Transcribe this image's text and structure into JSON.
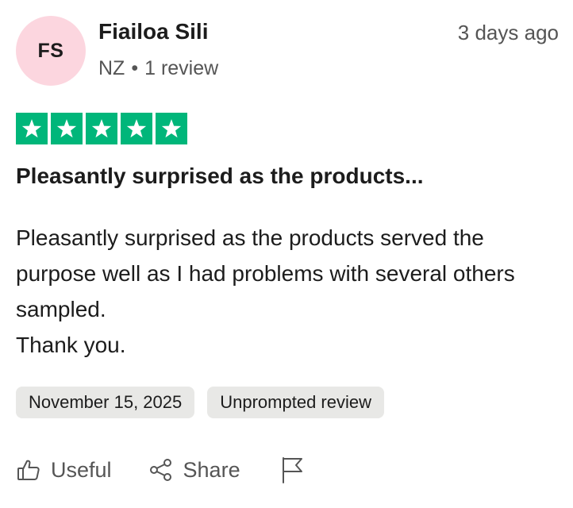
{
  "reviewer": {
    "initials": "FS",
    "name": "Fiailoa Sili",
    "country": "NZ",
    "separator": "•",
    "review_count": "1 review"
  },
  "review": {
    "date_ago": "3 days ago",
    "rating": 5,
    "rating_max": 5,
    "title": "Pleasantly surprised as the products...",
    "body_lines": [
      "Pleasantly surprised as the products served the purpose well as I had problems with several others sampled.",
      "Thank you."
    ],
    "experience_date": "November 15, 2025",
    "tag": "Unprompted review"
  },
  "actions": {
    "useful_label": "Useful",
    "share_label": "Share"
  },
  "colors": {
    "star_green": "#00b67a",
    "avatar_pink": "#fcd6df",
    "tag_bg": "#e8e8e6",
    "muted_text": "#555555"
  },
  "icons": {
    "star": "star-icon",
    "useful": "thumbs-up-icon",
    "share": "share-icon",
    "report": "flag-icon"
  }
}
